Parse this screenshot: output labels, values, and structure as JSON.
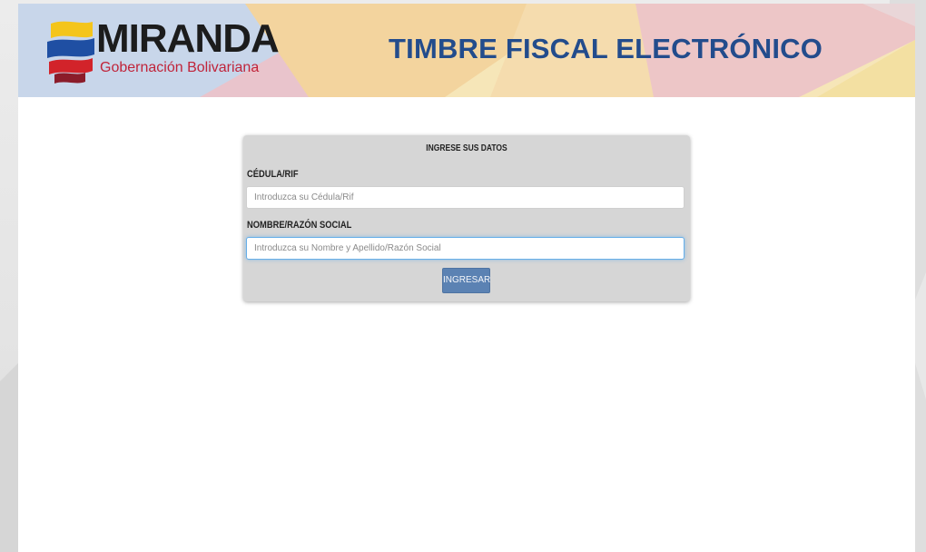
{
  "header": {
    "logo": {
      "wordmark": "MIRANDA",
      "subtitle": "Gobernación Bolivariana"
    },
    "title": "TIMBRE FISCAL ELECTRÓNICO"
  },
  "form": {
    "title": "INGRESE SUS DATOS",
    "fields": [
      {
        "label": "CÉDULA/RIF",
        "placeholder": "Introduzca su Cédula/Rif",
        "value": ""
      },
      {
        "label": "NOMBRE/RAZÓN SOCIAL",
        "placeholder": "Introduzca su Nombre y Apellido/Razón Social",
        "value": "",
        "focused": true
      }
    ],
    "submit_label": "INGRESAR"
  },
  "colors": {
    "title_blue": "#234c8c",
    "logo_red": "#c0243a",
    "button": "#5b82b3",
    "panel": "#d6d6d6",
    "focus_border": "#66afe9"
  }
}
